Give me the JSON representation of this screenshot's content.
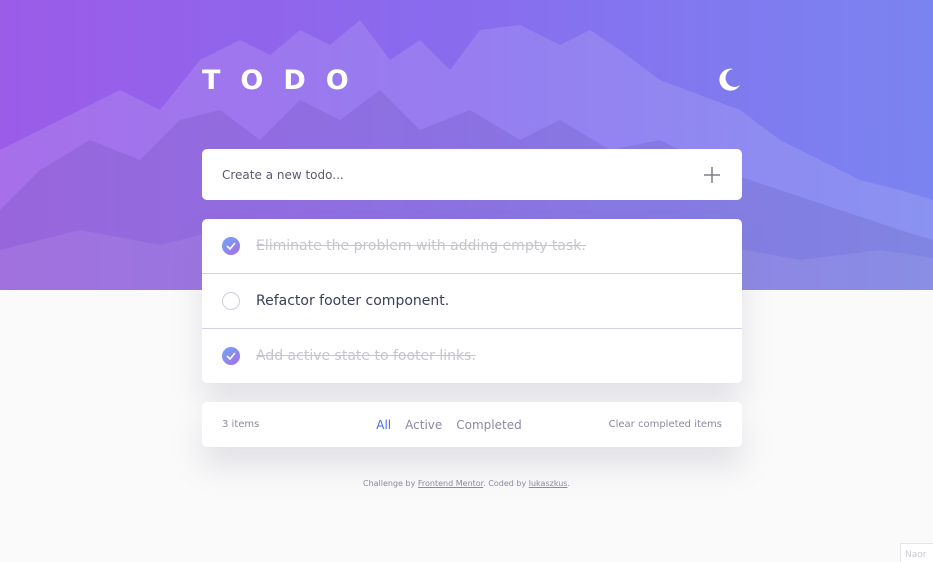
{
  "header": {
    "title": "TODO",
    "theme_icon": "moon-icon"
  },
  "new_todo": {
    "placeholder": "Create a new todo...",
    "add_icon": "plus-icon"
  },
  "todos": [
    {
      "text": "Eliminate the problem with adding empty task.",
      "completed": true
    },
    {
      "text": "Refactor footer component.",
      "completed": false
    },
    {
      "text": "Add active state to footer links.",
      "completed": true
    }
  ],
  "footer": {
    "items_left": "3 items",
    "filters": [
      "All",
      "Active",
      "Completed"
    ],
    "active_filter": "All",
    "clear_label": "Clear completed items"
  },
  "credit": {
    "prefix": "Challenge by",
    "link1": "Frontend Mentor",
    "middle": ". Coded by",
    "link2": "lukaszkus",
    "suffix": "."
  },
  "corner_widget": {
    "text": "Naor"
  },
  "colors": {
    "hero_gradient_start": "#9b5ce8",
    "hero_gradient_end": "#7a84f0",
    "accent": "#4a6cf7",
    "completed_text": "#c6c5cf"
  }
}
